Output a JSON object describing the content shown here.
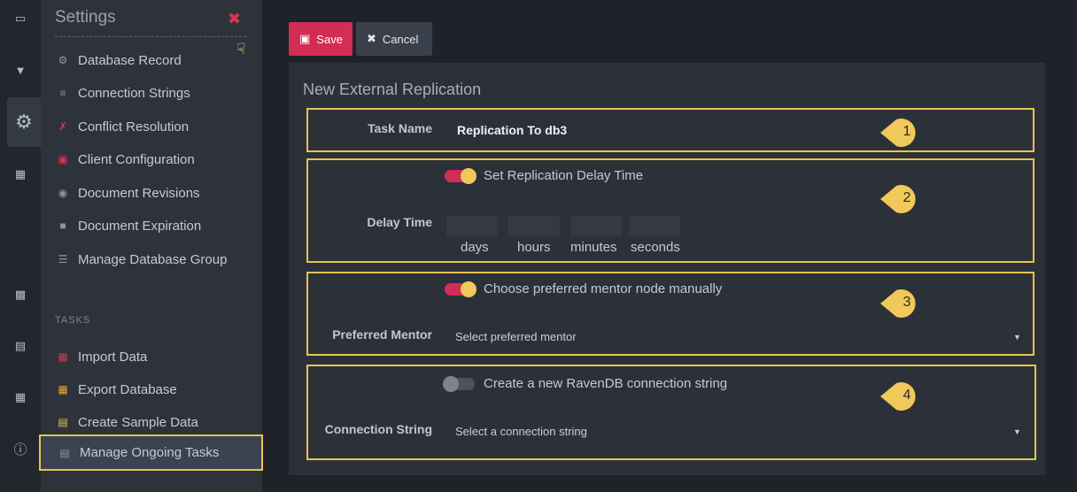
{
  "menu": {
    "title": "Settings",
    "items": [
      {
        "label": "Database Record",
        "icon": "database-record-icon"
      },
      {
        "label": "Connection Strings",
        "icon": "connection-strings-icon"
      },
      {
        "label": "Conflict Resolution",
        "icon": "conflict-resolution-icon"
      },
      {
        "label": "Client Configuration",
        "icon": "client-configuration-icon"
      },
      {
        "label": "Document Revisions",
        "icon": "document-revisions-icon"
      },
      {
        "label": "Document Expiration",
        "icon": "document-expiration-icon"
      },
      {
        "label": "Manage Database Group",
        "icon": "database-group-icon"
      }
    ],
    "tasks_heading": "TASKS",
    "tasks": [
      {
        "label": "Import Data",
        "icon": "import-data-icon"
      },
      {
        "label": "Export Database",
        "icon": "export-database-icon"
      },
      {
        "label": "Create Sample Data",
        "icon": "sample-data-icon"
      },
      {
        "label": "Manage Ongoing Tasks",
        "icon": "ongoing-tasks-icon"
      }
    ]
  },
  "toolbar": {
    "save_label": "Save",
    "cancel_label": "Cancel"
  },
  "panel": {
    "title": "New External Replication",
    "task_name": {
      "label": "Task Name",
      "value": "Replication To db3"
    },
    "delay": {
      "toggle_label": "Set Replication Delay Time",
      "toggle_on": true,
      "label": "Delay Time",
      "units": [
        "days",
        "hours",
        "minutes",
        "seconds"
      ]
    },
    "mentor": {
      "toggle_label": "Choose preferred mentor node manually",
      "toggle_on": true,
      "label": "Preferred Mentor",
      "placeholder": "Select preferred mentor"
    },
    "connection": {
      "toggle_label": "Create a new RavenDB connection string",
      "toggle_on": false,
      "label": "Connection String",
      "placeholder": "Select a connection string"
    },
    "markers": [
      "1",
      "2",
      "3",
      "4"
    ]
  },
  "colors": {
    "accent": "#d22d54",
    "highlight": "#e9c24e",
    "marker": "#f1c85a",
    "panel": "#2c3139"
  }
}
